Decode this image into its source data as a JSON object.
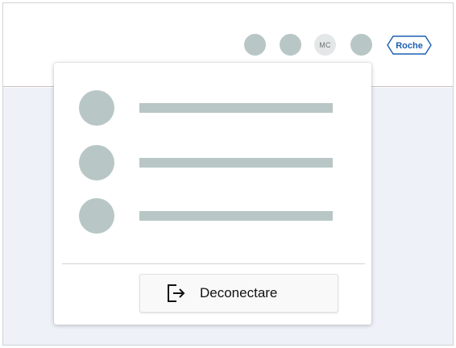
{
  "header": {
    "avatar_initials": "MC",
    "logo_text": "Roche",
    "nav_icons": [
      "placeholder-icon",
      "placeholder-icon",
      "placeholder-icon"
    ]
  },
  "user_menu": {
    "items": [
      {
        "icon": "placeholder-icon"
      },
      {
        "icon": "placeholder-icon"
      },
      {
        "icon": "placeholder-icon"
      }
    ],
    "logout": {
      "label": "Deconectare",
      "icon": "logout-icon"
    }
  },
  "colors": {
    "placeholder": "#b8c7c5",
    "background": "#eef2f8",
    "brand": "#1b5fb0"
  }
}
